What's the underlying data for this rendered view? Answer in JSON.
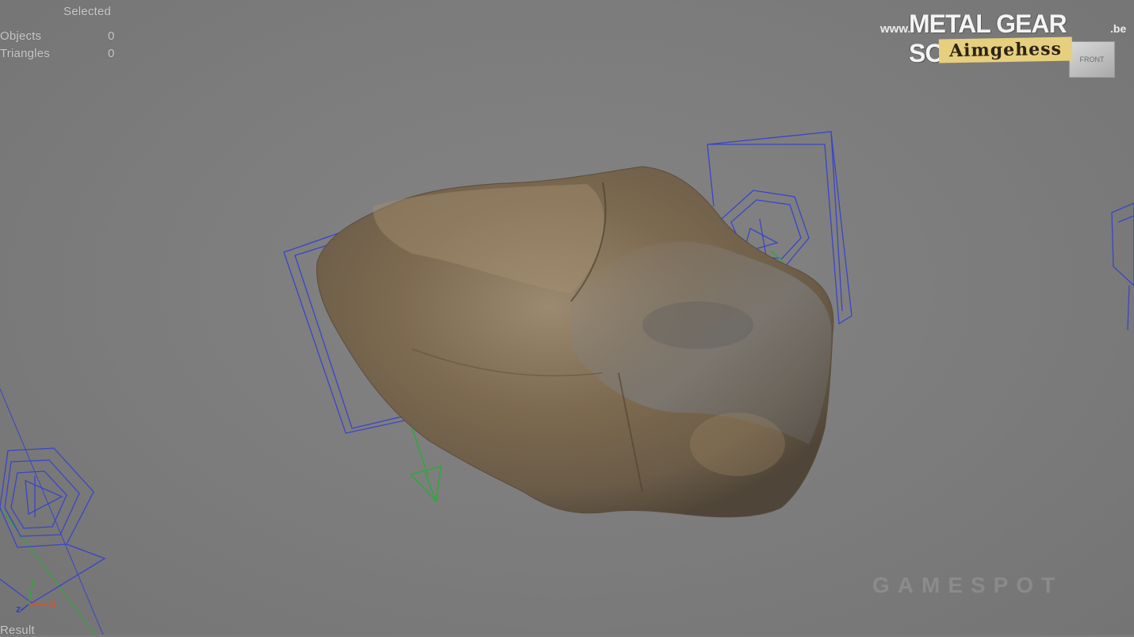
{
  "viewport": {
    "stats": {
      "selected_header": "Selected",
      "objects_label": "Objects",
      "objects_value": "0",
      "triangles_label": "Triangles",
      "triangles_value": "0"
    },
    "result_label": "Result",
    "axis_labels": {
      "x": "X",
      "z": "z"
    },
    "view_cube_label": "FRONT"
  },
  "watermark": {
    "prefix": "www.",
    "name": "METAL GEAR SOLID",
    "suffix": ".be",
    "tagline": "Aimgehess",
    "broadcaster": "GAMESPOT"
  },
  "scene": {
    "object": "rock-mesh",
    "camera_gizmo_color": "#3a45c8",
    "axis_green": "#2fa83a",
    "rock_colors": [
      "#7a6548",
      "#8a7a62",
      "#6d6a66",
      "#9a8660"
    ]
  }
}
